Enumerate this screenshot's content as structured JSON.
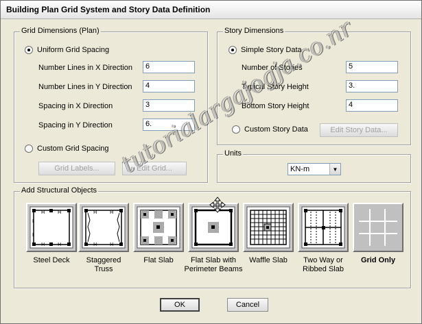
{
  "window": {
    "title": "Building Plan Grid System and Story Data Definition"
  },
  "grid_dimensions": {
    "group_label": "Grid Dimensions (Plan)",
    "uniform_label": "Uniform Grid Spacing",
    "num_lines_x_label": "Number Lines in X Direction",
    "num_lines_x_value": "6",
    "num_lines_y_label": "Number Lines in Y Direction",
    "num_lines_y_value": "4",
    "spacing_x_label": "Spacing in X Direction",
    "spacing_x_value": "3",
    "spacing_y_label": "Spacing in Y Direction",
    "spacing_y_value": "6.",
    "custom_label": "Custom Grid Spacing",
    "grid_labels_button": "Grid Labels...",
    "edit_grid_button": "Edit Grid..."
  },
  "story_dimensions": {
    "group_label": "Story Dimensions",
    "simple_label": "Simple Story Data",
    "num_stories_label": "Number of Stories",
    "num_stories_value": "5",
    "typical_height_label": "Typical Story Height",
    "typical_height_value": "3.",
    "bottom_height_label": "Bottom Story Height",
    "bottom_height_value": "4",
    "custom_label": "Custom Story Data",
    "edit_story_button": "Edit Story Data..."
  },
  "units": {
    "group_label": "Units",
    "selected": "KN-m"
  },
  "structural_objects": {
    "group_label": "Add Structural Objects",
    "items": [
      {
        "label1": "Steel Deck",
        "label2": ""
      },
      {
        "label1": "Staggered",
        "label2": "Truss"
      },
      {
        "label1": "Flat Slab",
        "label2": ""
      },
      {
        "label1": "Flat Slab with",
        "label2": "Perimeter Beams"
      },
      {
        "label1": "Waffle Slab",
        "label2": ""
      },
      {
        "label1": "Two Way or",
        "label2": "Ribbed Slab"
      },
      {
        "label1": "Grid Only",
        "label2": ""
      }
    ]
  },
  "buttons": {
    "ok": "OK",
    "cancel": "Cancel"
  },
  "watermark": {
    "text": "tutorialargajogja.co.nr"
  }
}
